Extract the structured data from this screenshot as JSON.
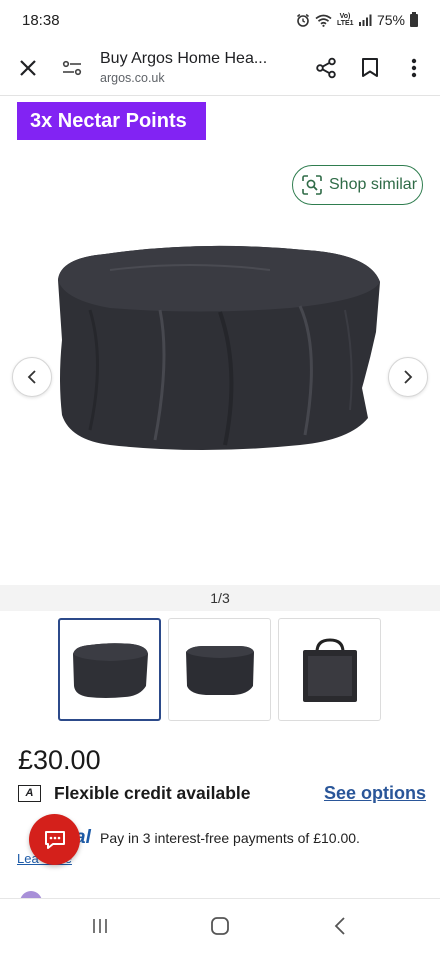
{
  "status_bar": {
    "time": "18:38",
    "network": "Vo) LTE1",
    "battery": "75%",
    "icons": [
      "alarm-icon",
      "wifi-icon",
      "signal-icon",
      "battery-icon"
    ]
  },
  "toolbar": {
    "title": "Buy Argos Home Hea...",
    "url": "argos.co.uk",
    "icons": [
      "close-icon",
      "page-settings-icon",
      "share-icon",
      "bookmark-icon",
      "more-vert-icon"
    ]
  },
  "nectar_badge": "3x Nectar Points",
  "shop_similar": "Shop similar",
  "pager": "1/3",
  "price": "£30.00",
  "credit": {
    "icon_letter": "A",
    "text": "Flexible credit available",
    "link": "See options"
  },
  "paypal": {
    "logo_text": "al",
    "text": "Pay in 3 interest-free payments of £10.00.",
    "learn_more": "Learn more",
    "learn_more_visible": "Lea    ore"
  },
  "colors": {
    "nectar_purple": "#8223f3",
    "shop_similar_green": "#2f7d4f",
    "link_blue": "#2a5699",
    "chat_red": "#d4201b",
    "thumb_active_border": "#2c4a8a"
  },
  "navbar": {
    "icons": [
      "recent-apps-icon",
      "home-icon",
      "back-icon"
    ]
  }
}
